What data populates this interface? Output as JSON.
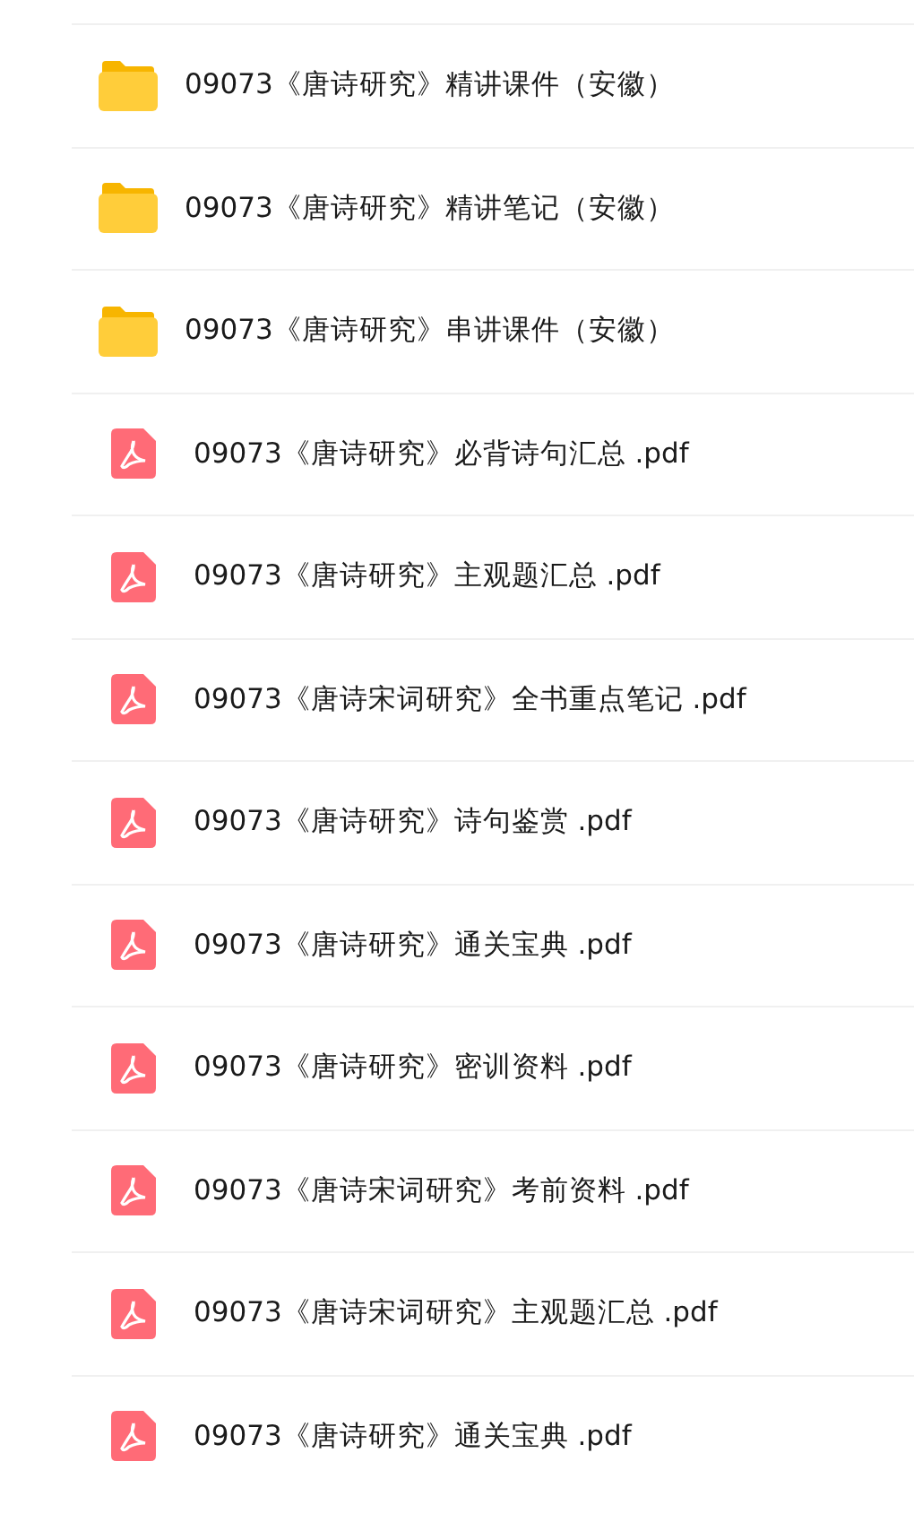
{
  "files": [
    {
      "kind": "folder",
      "name": "09073《唐诗研究》精讲课件（安徽）"
    },
    {
      "kind": "folder",
      "name": "09073《唐诗研究》精讲笔记（安徽）"
    },
    {
      "kind": "folder",
      "name": "09073《唐诗研究》串讲课件（安徽）"
    },
    {
      "kind": "pdf",
      "name": "09073《唐诗研究》必背诗句汇总 .pdf"
    },
    {
      "kind": "pdf",
      "name": "09073《唐诗研究》主观题汇总 .pdf"
    },
    {
      "kind": "pdf",
      "name": "09073《唐诗宋词研究》全书重点笔记 .pdf"
    },
    {
      "kind": "pdf",
      "name": "09073《唐诗研究》诗句鉴赏 .pdf"
    },
    {
      "kind": "pdf",
      "name": "09073《唐诗研究》通关宝典 .pdf"
    },
    {
      "kind": "pdf",
      "name": "09073《唐诗研究》密训资料 .pdf"
    },
    {
      "kind": "pdf",
      "name": "09073《唐诗宋词研究》考前资料 .pdf"
    },
    {
      "kind": "pdf",
      "name": "09073《唐诗宋词研究》主观题汇总 .pdf"
    },
    {
      "kind": "pdf",
      "name": "09073《唐诗研究》通关宝典 .pdf"
    }
  ]
}
